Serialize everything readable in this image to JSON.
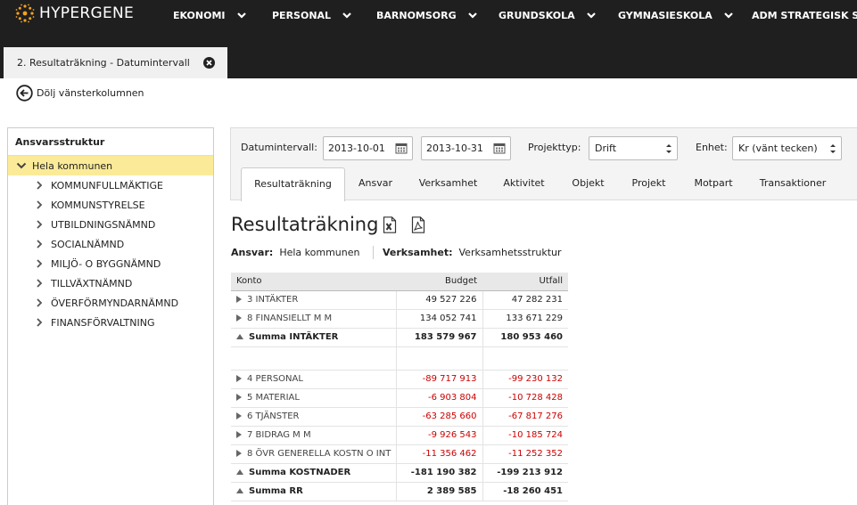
{
  "brand": {
    "name": "HYPERGENE",
    "accent": "#f6a21e"
  },
  "nav": {
    "items": [
      {
        "label": "EKONOMI"
      },
      {
        "label": "PERSONAL"
      },
      {
        "label": "BARNOMSORG"
      },
      {
        "label": "GRUNDSKOLA"
      },
      {
        "label": "GYMNASIESKOLA"
      },
      {
        "label": "ADM STRATEGISK STYR"
      }
    ]
  },
  "doc_tab": {
    "title": "2. Resultaträkning - Datumintervall"
  },
  "toggle_left": {
    "label": "Dölj vänsterkolumnen"
  },
  "sidebar": {
    "title": "Ansvarsstruktur",
    "root": "Hela kommunen",
    "items": [
      {
        "label": "KOMMUNFULLMÄKTIGE"
      },
      {
        "label": "KOMMUNSTYRELSE"
      },
      {
        "label": "UTBILDNINGSNÄMND"
      },
      {
        "label": "SOCIALNÄMND"
      },
      {
        "label": "MILJÖ- O BYGGNÄMND"
      },
      {
        "label": "TILLVÄXTNÄMND"
      },
      {
        "label": "ÖVERFÖRMYNDARNÄMND"
      },
      {
        "label": "FINANSFÖRVALTNING"
      }
    ]
  },
  "filters": {
    "date_label": "Datumintervall:",
    "date_from": "2013-10-01",
    "date_to": "2013-10-31",
    "project_type_label": "Projekttyp:",
    "project_type_value": "Drift",
    "unit_label": "Enhet:",
    "unit_value": "Kr (vänt tecken)"
  },
  "tabs": [
    {
      "label": "Resultaträkning"
    },
    {
      "label": "Ansvar"
    },
    {
      "label": "Verksamhet"
    },
    {
      "label": "Aktivitet"
    },
    {
      "label": "Objekt"
    },
    {
      "label": "Projekt"
    },
    {
      "label": "Motpart"
    },
    {
      "label": "Transaktioner"
    }
  ],
  "report": {
    "title": "Resultaträkning",
    "meta": {
      "ansvar_label": "Ansvar:",
      "ansvar_value": "Hela kommunen",
      "verksamhet_label": "Verksamhet:",
      "verksamhet_value": "Verksamhetsstruktur"
    },
    "table": {
      "headers": {
        "konto": "Konto",
        "budget": "Budget",
        "utfall": "Utfall"
      },
      "rows": [
        {
          "konto": "3 INTÄKTER",
          "budget": "49 527 226",
          "utfall": "47 282 231"
        },
        {
          "konto": "8 FINANSIELLT M M",
          "budget": "134 052 741",
          "utfall": "133 671 229"
        },
        {
          "konto": "Summa INTÄKTER",
          "budget": "183 579 967",
          "utfall": "180 953 460"
        },
        {
          "konto": "4 PERSONAL",
          "budget": "-89 717 913",
          "utfall": "-99 230 132"
        },
        {
          "konto": "5 MATERIAL",
          "budget": "-6 903 804",
          "utfall": "-10 728 428"
        },
        {
          "konto": "6 TJÄNSTER",
          "budget": "-63 285 660",
          "utfall": "-67 817 276"
        },
        {
          "konto": "7 BIDRAG M M",
          "budget": "-9 926 543",
          "utfall": "-10 185 724"
        },
        {
          "konto": "8 ÖVR GENERELLA KOSTN O INT",
          "budget": "-11 356 462",
          "utfall": "-11 252 352"
        },
        {
          "konto": "Summa KOSTNADER",
          "budget": "-181 190 382",
          "utfall": "-199 213 912"
        },
        {
          "konto": "Summa RR",
          "budget": "2 389 585",
          "utfall": "-18 260 451"
        }
      ]
    }
  }
}
